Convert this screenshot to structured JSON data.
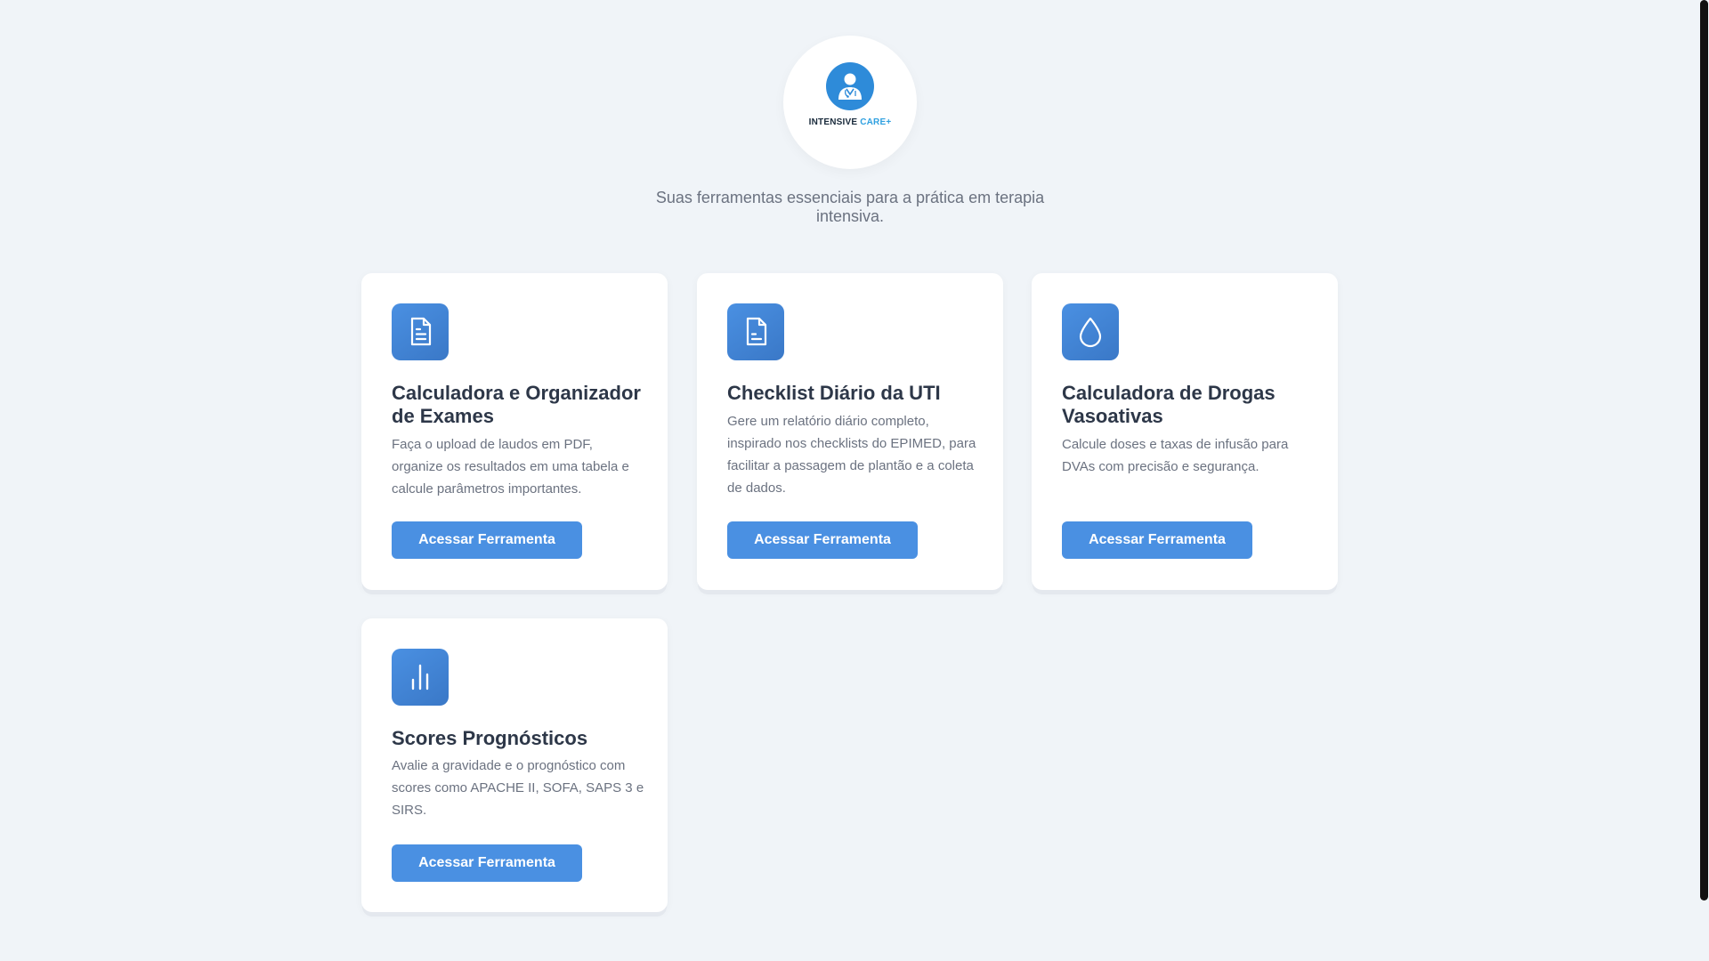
{
  "brand": {
    "logo_text_main": "INTENSIVE",
    "logo_text_accent": "CARE+",
    "icon": "doctor-icon",
    "primary_color": "#4a90e2",
    "logo_color": "#2e8bd9"
  },
  "header": {
    "tagline": "Suas ferramentas essenciais para a prática em terapia intensiva."
  },
  "tools": [
    {
      "icon": "document-icon",
      "title": "Calculadora e Organizador de Exames",
      "description": "Faça o upload de laudos em PDF, organize os resultados em uma tabela e calcule parâmetros importantes.",
      "button_label": "Acessar Ferramenta"
    },
    {
      "icon": "document-icon",
      "title": "Checklist Diário da UTI",
      "description": "Gere um relatório diário completo, inspirado nos checklists do EPIMED, para facilitar a passagem de plantão e a coleta de dados.",
      "button_label": "Acessar Ferramenta"
    },
    {
      "icon": "droplet-icon",
      "title": "Calculadora de Drogas Vasoativas",
      "description": "Calcule doses e taxas de infusão para DVAs com precisão e segurança.",
      "button_label": "Acessar Ferramenta"
    },
    {
      "icon": "bar-chart-icon",
      "title": "Scores Prognósticos",
      "description": "Avalie a gravidade e o prognóstico com scores como APACHE II, SOFA, SAPS 3 e SIRS.",
      "button_label": "Acessar Ferramenta"
    }
  ]
}
